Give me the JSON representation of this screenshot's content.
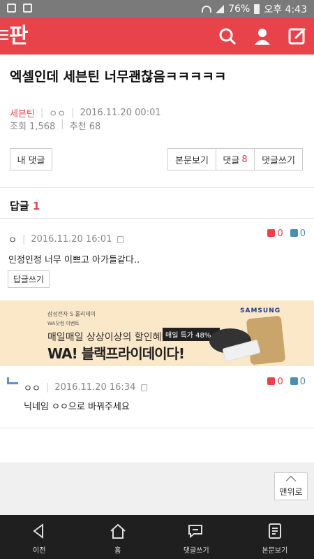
{
  "status_bar": {
    "battery": "76%",
    "time": "오후 4:43"
  },
  "app_bar": {
    "logo": "판",
    "icons": [
      "search-icon",
      "user-icon",
      "write-icon"
    ]
  },
  "post": {
    "title": "엑셀인데 세븐틴 너무괜찮음ㅋㅋㅋㅋㅋ",
    "author": "세븐틴",
    "author_id": "ㅇㅇ",
    "date": "2016.11.20 00:01",
    "views": "조회 1,568",
    "likes": "추천 68"
  },
  "buttons": {
    "my_comments": "내 댓글",
    "view_post": "본문보기",
    "comments_label": "댓글",
    "comments_count": "8",
    "write_comment": "댓글쓰기"
  },
  "replies": {
    "label": "답글",
    "count": "1"
  },
  "comments": [
    {
      "nick": "ㅇ",
      "date": "2016.11.20 16:01",
      "up": "0",
      "down": "0",
      "text": "인정인정 너무 이쁘고 아가들같다..",
      "reply_button": "답글쓰기"
    },
    {
      "nick": "ㅇㅇ",
      "date": "2016.11.20 16:34",
      "up": "0",
      "down": "0",
      "text": "닉네임 ㅇㅇ으로 바꿔주세요"
    }
  ],
  "ad": {
    "small1": "삼성전자 S 홀리데이",
    "small2": "WA닷컴 이벤트",
    "line1": "매일매일 상상이상의 할인혜택",
    "badge": "매일 특가 48%~",
    "line2": "WA! 블랙프라이데이다!",
    "brand": "SAMSUNG"
  },
  "to_top": "맨위로",
  "nav": [
    {
      "label": "이전",
      "icon": "back-icon"
    },
    {
      "label": "홈",
      "icon": "home-icon"
    },
    {
      "label": "댓글쓰기",
      "icon": "comment-write-icon"
    },
    {
      "label": "본문보기",
      "icon": "document-icon"
    }
  ],
  "colors": {
    "accent": "#e8434a",
    "down": "#4a8fb0"
  }
}
